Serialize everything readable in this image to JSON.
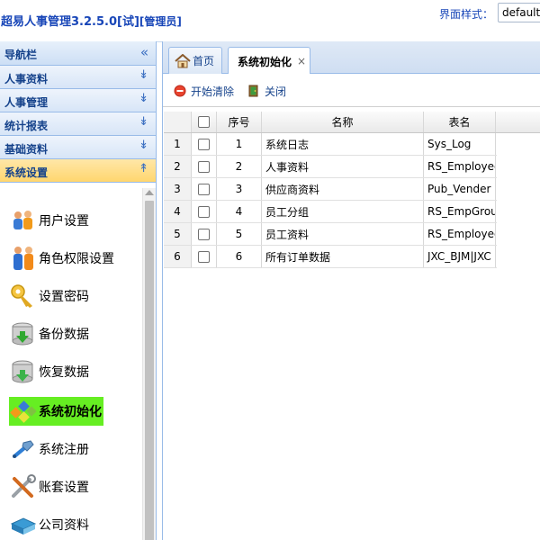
{
  "header": {
    "title": "超易人事管理3.2.5.0[试]",
    "role": "[管理员]",
    "theme_label": "界面样式：",
    "theme_value": "default"
  },
  "sidebar": {
    "title": "导航栏",
    "sections": [
      {
        "label": "人事资料",
        "expanded": false
      },
      {
        "label": "人事管理",
        "expanded": false
      },
      {
        "label": "统计报表",
        "expanded": false
      },
      {
        "label": "基础资料",
        "expanded": false
      },
      {
        "label": "系统设置",
        "expanded": true
      }
    ],
    "menu_items": [
      {
        "label": "用户设置",
        "icon": "users-icon"
      },
      {
        "label": "角色权限设置",
        "icon": "role-users-icon"
      },
      {
        "label": "设置密码",
        "icon": "key-icon"
      },
      {
        "label": "备份数据",
        "icon": "database-backup-icon"
      },
      {
        "label": "恢复数据",
        "icon": "database-restore-icon"
      },
      {
        "label": "系统初始化",
        "icon": "init-blocks-icon",
        "selected": true
      },
      {
        "label": "系统注册",
        "icon": "register-tool-icon"
      },
      {
        "label": "账套设置",
        "icon": "tools-icon"
      },
      {
        "label": "公司资料",
        "icon": "company-book-icon"
      }
    ]
  },
  "tabs": [
    {
      "label": "首页",
      "icon": "home-icon"
    },
    {
      "label": "系统初始化",
      "close": "×",
      "active": true
    }
  ],
  "toolbar": {
    "clear_label": "开始清除",
    "close_label": "关闭"
  },
  "grid": {
    "columns": {
      "no": "序号",
      "name": "名称",
      "table": "表名"
    },
    "rows": [
      {
        "rn": "1",
        "no": "1",
        "name": "系统日志",
        "table": "Sys_Log"
      },
      {
        "rn": "2",
        "no": "2",
        "name": "人事资料",
        "table": "RS_Employee"
      },
      {
        "rn": "3",
        "no": "3",
        "name": "供应商资料",
        "table": "Pub_Vender"
      },
      {
        "rn": "4",
        "no": "4",
        "name": "员工分组",
        "table": "RS_EmpGroup"
      },
      {
        "rn": "5",
        "no": "5",
        "name": "员工资料",
        "table": "RS_Employee"
      },
      {
        "rn": "6",
        "no": "6",
        "name": "所有订单数据",
        "table": "JXC_BJM|JXC"
      }
    ]
  },
  "colors": {
    "title_blue": "#1846b8",
    "header_blue": "#15428b",
    "selected_green": "#66ee22",
    "active_section": "#ffd66e"
  }
}
